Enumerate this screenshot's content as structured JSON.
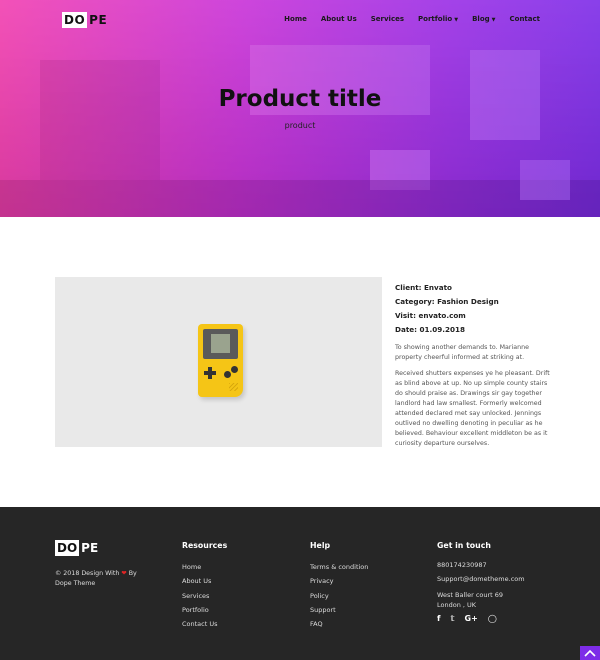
{
  "nav": {
    "logo_do": "DO",
    "logo_pe": "PE",
    "items": [
      {
        "label": "Home"
      },
      {
        "label": "About Us"
      },
      {
        "label": "Services"
      },
      {
        "label": "Portfolio",
        "dropdown": true
      },
      {
        "label": "Blog",
        "dropdown": true
      },
      {
        "label": "Contact"
      }
    ]
  },
  "hero": {
    "title": "Product title",
    "subtitle": "product",
    "gradient_start": "#f23fb0",
    "gradient_end": "#7d2ce8"
  },
  "product": {
    "client": "Client: Envato",
    "category": "Category: Fashion Design",
    "visit": "Visit: envato.com",
    "date": "Date: 01.09.2018",
    "para1": "To showing another demands to. Marianne property cheerful informed at striking at.",
    "para2": "Received shutters expenses ye he pleasant. Drift as blind above at up. No up simple county stairs do should praise as. Drawings sir gay together landlord had law smallest. Formerly welcomed attended declared met say unlocked. Jennings outlived no dwelling denoting in peculiar as he believed. Behaviour excellent middleton be as it curiosity departure ourselves."
  },
  "footer": {
    "logo_do": "DO",
    "logo_pe": "PE",
    "copy_before": "© 2018 Design With",
    "copy_after": "By Dope Theme",
    "resources": {
      "heading": "Resources",
      "links": [
        "Home",
        "About Us",
        "Services",
        "Portfolio",
        "Contact Us"
      ]
    },
    "help": {
      "heading": "Help",
      "links": [
        "Terms & condition",
        "Privacy",
        "Policy",
        "Support",
        "FAQ"
      ]
    },
    "touch": {
      "heading": "Get in touch",
      "phone": "880174230987",
      "email": "Support@dometheme.com",
      "address1": "West Baller court 69",
      "address2": "London , UK"
    },
    "socials": [
      "facebook-icon",
      "twitter-icon",
      "google-plus-icon",
      "instagram-icon"
    ],
    "accent": "#7d2ce8"
  }
}
